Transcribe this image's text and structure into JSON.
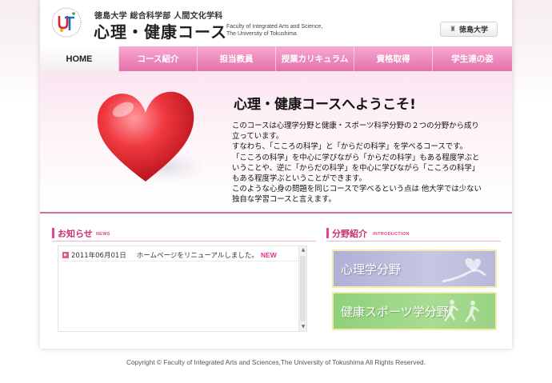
{
  "header": {
    "logo_letters": "UT",
    "university_department": "徳島大学 総合科学部 人間文化学科",
    "site_title": "心理・健康コース",
    "faculty_en_line1": "Faculty of Integrated Arts and Science,",
    "faculty_en_line2": "The University of Tokushima",
    "university_button_label": "徳島大学"
  },
  "nav": {
    "items": [
      {
        "label": "HOME"
      },
      {
        "label": "コース紹介"
      },
      {
        "label": "担当教員"
      },
      {
        "label": "授業カリキュラム"
      },
      {
        "label": "資格取得"
      },
      {
        "label": "学生達の姿"
      }
    ]
  },
  "hero": {
    "title": "心理・健康コースへようこそ!",
    "body_lines": [
      "このコースは心理学分野と健康・スポーツ科学分野の２つの分野から成り",
      "立っています。",
      "すなわち、「こころの科学」と「からだの科学」を学べるコースです。",
      "「こころの科学」を中心に学びながら「からだの科学」もある程度学ぶと",
      "いうことや、逆に「からだの科学」を中心に学びながら「こころの科学」",
      "もある程度学ぶということができます。",
      "このような心身の問題を同じコースで学べるという点は 他大学では少ない",
      "独自な学習コースと言えます。"
    ]
  },
  "news": {
    "heading": "お知らせ",
    "heading_sub": "NEWS",
    "items": [
      {
        "date": "2011年06月01日",
        "text": "ホームページをリニューアルしました。",
        "badge": "NEW"
      }
    ]
  },
  "fields": {
    "heading": "分野紹介",
    "heading_sub": "INTRODUCTION",
    "banners": [
      {
        "label": "心理学分野"
      },
      {
        "label": "健康スポーツ学分野"
      }
    ]
  },
  "footer": {
    "copyright": "Copyright © Faculty of Integrated Arts and Sciences,The University of Tokushima All Rights Reserved."
  },
  "colors": {
    "nav_pink": "#e56fab",
    "accent_pink": "#c8306f",
    "new_badge": "#e8338d",
    "psych_banner": "#aeb0d6",
    "health_banner": "#8fd17a"
  },
  "icons": {
    "heart": "heart-illustration",
    "news_bullet": "arrow-bullet-icon",
    "univ_button": "university-icon"
  }
}
